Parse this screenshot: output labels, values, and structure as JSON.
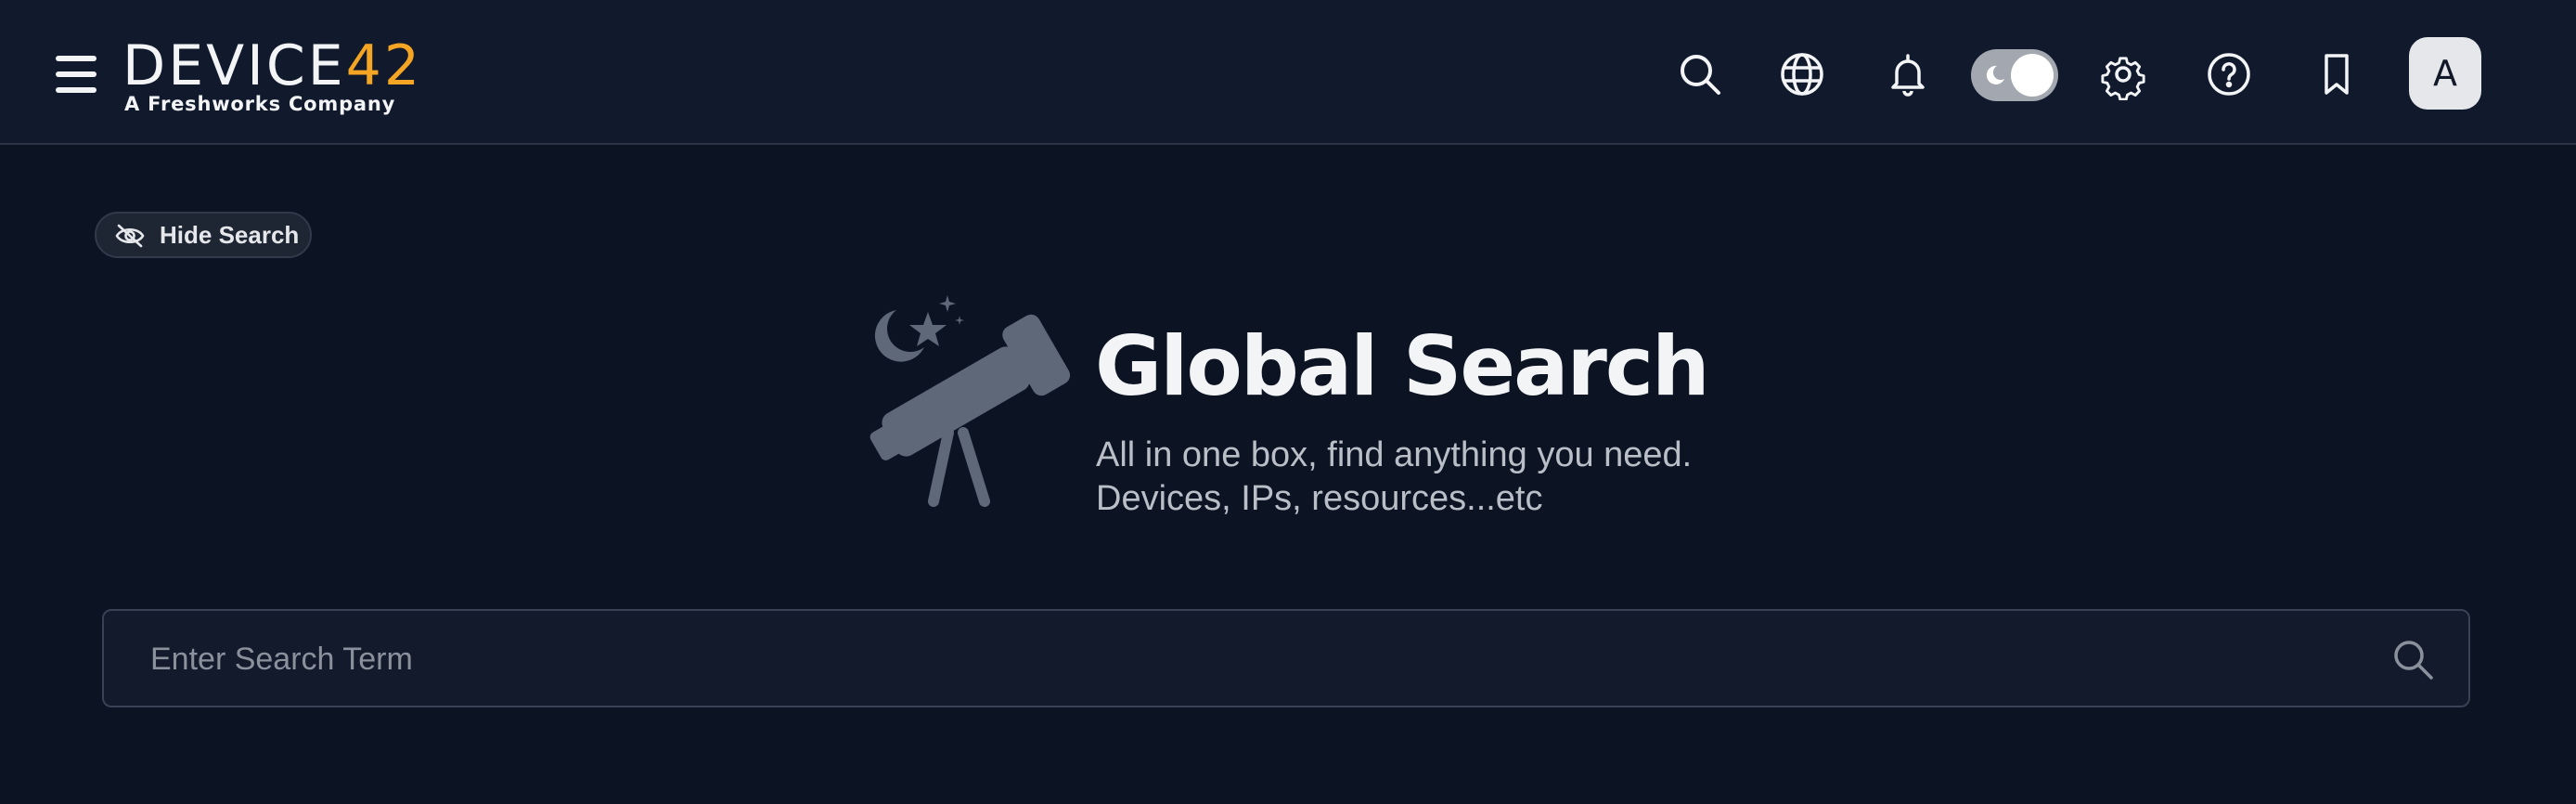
{
  "header": {
    "logo": {
      "word_main": "DEVICE",
      "word_accent": "42",
      "tagline": "A Freshworks Company"
    },
    "icons": [
      "menu-icon",
      "search-icon",
      "globe-icon",
      "bell-icon",
      "theme-toggle",
      "gear-icon",
      "help-icon",
      "bookmark-icon"
    ],
    "avatar_initial": "A",
    "accent_color": "#f5a524"
  },
  "hide_search": {
    "label": "Hide Search",
    "icon": "eye-off-icon"
  },
  "hero": {
    "title": "Global Search",
    "subtitle_line1": "All in one box, find anything you need.",
    "subtitle_line2": "Devices, IPs, resources...etc",
    "illustration": "telescope-icon"
  },
  "search": {
    "placeholder": "Enter Search Term",
    "value": "",
    "icon": "search-icon"
  }
}
